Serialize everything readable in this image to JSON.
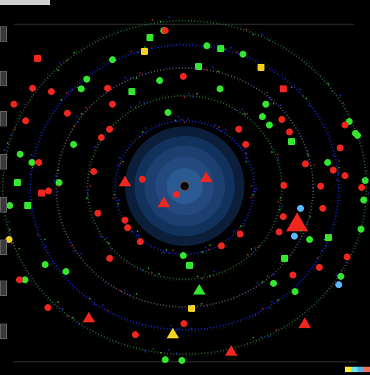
{
  "scene": {
    "background": "#000000",
    "hub": {
      "colors": [
        "#0b1f3a",
        "#12325e",
        "#1c3f70",
        "#23497e",
        "#2b5a92"
      ],
      "core_color": "#0a0a0a"
    },
    "ring_colors": [
      "#1b2cff",
      "#2e7d3a",
      "#6b6b6b"
    ],
    "entity_colors": {
      "green": "#33e62e",
      "red": "#f0261f",
      "yellow": "#f2d21e",
      "cyan": "#5ab8ff"
    },
    "icons": {
      "red": "enemy-unit-icon",
      "green": "ally-unit-icon",
      "yellow": "resource-icon",
      "cyan": "beacon-icon"
    }
  },
  "ui": {
    "top_bar_color": "#cfcfcf",
    "side_buttons": 8,
    "watermark_colors": [
      "#f6e93b",
      "#6de0f1",
      "#56b0d9",
      "#f06d5a"
    ]
  }
}
